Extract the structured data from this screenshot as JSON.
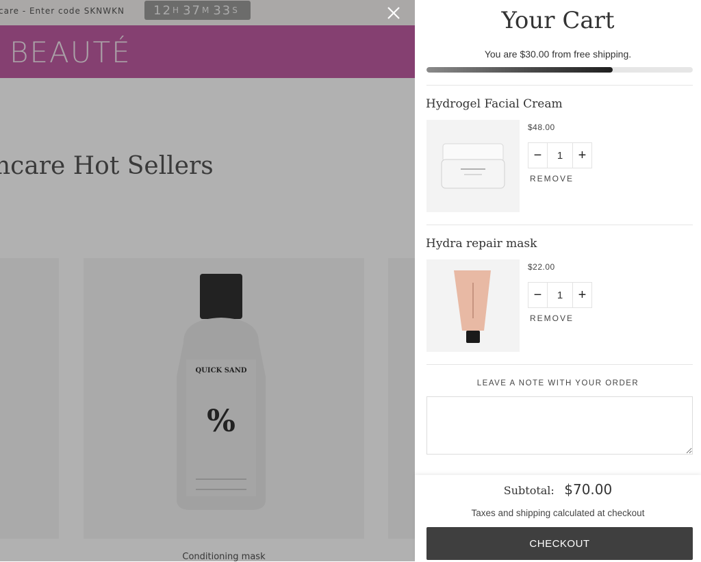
{
  "background": {
    "announcement": "care - Enter code SKNWKN",
    "countdown": {
      "hours": "12",
      "h_unit": "H",
      "minutes": "37",
      "m_unit": "M",
      "seconds": "33",
      "s_unit": "S"
    },
    "brand": "BEAUTÉ",
    "section_title": "ncare Hot Sellers",
    "product": {
      "name": "Conditioning mask",
      "bottle_brand": "QUICK SAND",
      "bottle_mark": "%"
    }
  },
  "cart": {
    "title": "Your Cart",
    "shipping_message": "You are $30.00 from free shipping.",
    "shipping_progress": 0.7,
    "items": [
      {
        "name": "Hydrogel Facial Cream",
        "price": "$48.00",
        "quantity": "1",
        "remove_label": "REMOVE",
        "minus": "−",
        "plus": "+"
      },
      {
        "name": "Hydra repair mask",
        "price": "$22.00",
        "quantity": "1",
        "remove_label": "REMOVE",
        "minus": "−",
        "plus": "+"
      }
    ],
    "note_label": "LEAVE A NOTE WITH YOUR ORDER",
    "note_value": "",
    "subtotal_label": "Subtotal:",
    "subtotal_value": "$70.00",
    "tax_note": "Taxes and shipping calculated at checkout",
    "checkout_label": "CHECKOUT"
  },
  "colors": {
    "brand_bar": "#b64494",
    "checkout_button": "#3f3f3f"
  }
}
